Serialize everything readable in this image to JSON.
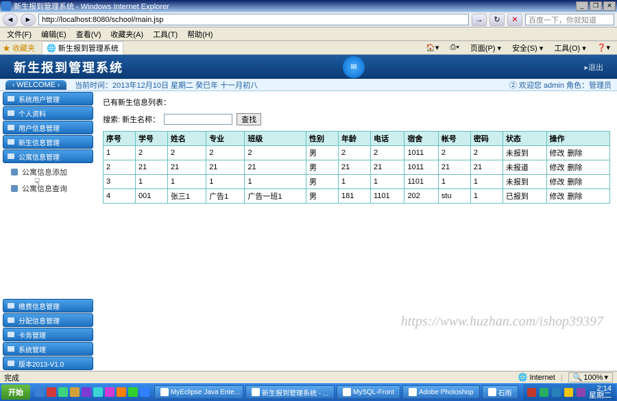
{
  "window": {
    "title": "新生报到管理系统 - Windows Internet Explorer",
    "url": "http://localhost:8080/school/main.jsp",
    "search_placeholder": "百度一下，你就知道"
  },
  "ie_menu": [
    "文件(F)",
    "编辑(E)",
    "查看(V)",
    "收藏夹(A)",
    "工具(T)",
    "帮助(H)"
  ],
  "fav_bar": {
    "label": "收藏夹",
    "tab": "新生报到管理系统"
  },
  "ie_tools": [
    "🏠▾",
    "⎙▾",
    "页面(P) ▾",
    "安全(S) ▾",
    "工具(O) ▾",
    "❓▾"
  ],
  "app": {
    "title": "新生报到管理系统",
    "exit": "退出",
    "welcome": "WELCOME",
    "time_text": "当前时间：2013年12月10日 星期二 癸巳年 十一月初八",
    "login_text": "② 欢迎您 admin 角色：管理员"
  },
  "sidebar_top": [
    "系统用户管理",
    "个人资料",
    "用户信息管理",
    "新生信息管理",
    "公寓信息管理"
  ],
  "sidebar_sub": [
    "公寓信息添加",
    "公寓信息查询"
  ],
  "sidebar_bottom": [
    "缴费信息管理",
    "分配信息管理",
    "卡务管理",
    "系统管理",
    "版本2013-V1.0"
  ],
  "content": {
    "list_title": "已有新生信息列表：",
    "search_label": "搜索:  新生名称：",
    "search_btn": "查找"
  },
  "table": {
    "headers": [
      "序号",
      "学号",
      "姓名",
      "专业",
      "班级",
      "性别",
      "年龄",
      "电话",
      "宿舍",
      "帐号",
      "密码",
      "状态",
      "操作"
    ],
    "rows": [
      [
        "1",
        "2",
        "2",
        "2",
        "2",
        "男",
        "2",
        "2",
        "1011",
        "2",
        "2",
        "未报到"
      ],
      [
        "2",
        "21",
        "21",
        "21",
        "21",
        "男",
        "21",
        "21",
        "1011",
        "21",
        "21",
        "未报道"
      ],
      [
        "3",
        "1",
        "1",
        "1",
        "1",
        "男",
        "1",
        "1",
        "1101",
        "1",
        "1",
        "未报到"
      ],
      [
        "4",
        "001",
        "张三1",
        "广告1",
        "广告一班1",
        "男",
        "181",
        "1101",
        "202",
        "stu",
        "1",
        "已报到"
      ]
    ],
    "ops": {
      "edit": "修改",
      "del": "删除"
    }
  },
  "watermark": "https://www.huzhan.com/ishop39397",
  "status": {
    "done": "完成",
    "zone": "Internet",
    "zoom": "100%"
  },
  "taskbar": {
    "start": "开始",
    "items": [
      "MyEclipse Java Ente...",
      "新生报到管理系统 - ...",
      "MySQL-Front",
      "Adobe Photoshop",
      "石雨"
    ],
    "clock_time": "2:14",
    "clock_day": "星期二"
  }
}
